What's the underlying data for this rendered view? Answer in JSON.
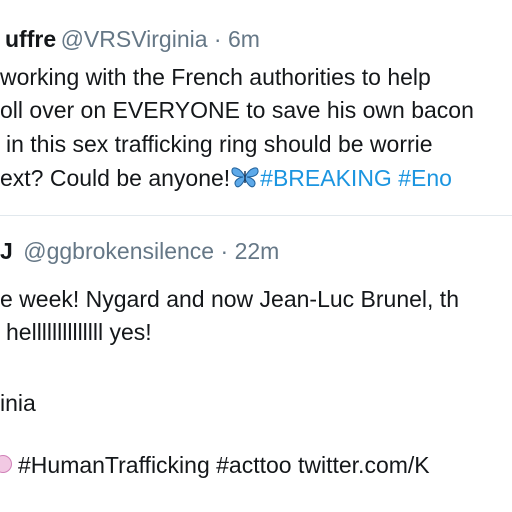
{
  "tweet1": {
    "name": "uffre",
    "handle": "@VRSVirginia",
    "sep": " · ",
    "time": "6m",
    "lines": [
      "working with the French authorities to help",
      "oll over on EVERYONE to save his own bacon",
      "in this sex trafficking ring should be worrie",
      "ext? Could be anyone!"
    ],
    "emoji": "butterfly-icon",
    "hashtags": [
      "#BREAKING",
      "#Eno"
    ]
  },
  "tweet2": {
    "name": "J",
    "handle": "@ggbrokensilence",
    "sep": " · ",
    "time": "22m",
    "lines": [
      "e week! Nygard and now Jean-Luc Brunel, th",
      "hellllllllllllll yes!",
      "inia"
    ],
    "emoji": "pink-circle-icon",
    "footer": "#HumanTrafficking #acttoo twitter.com/K"
  },
  "colors": {
    "link": "#1b95e0",
    "muted": "#657786",
    "text": "#14171a",
    "divider": "#e1e8ed"
  }
}
